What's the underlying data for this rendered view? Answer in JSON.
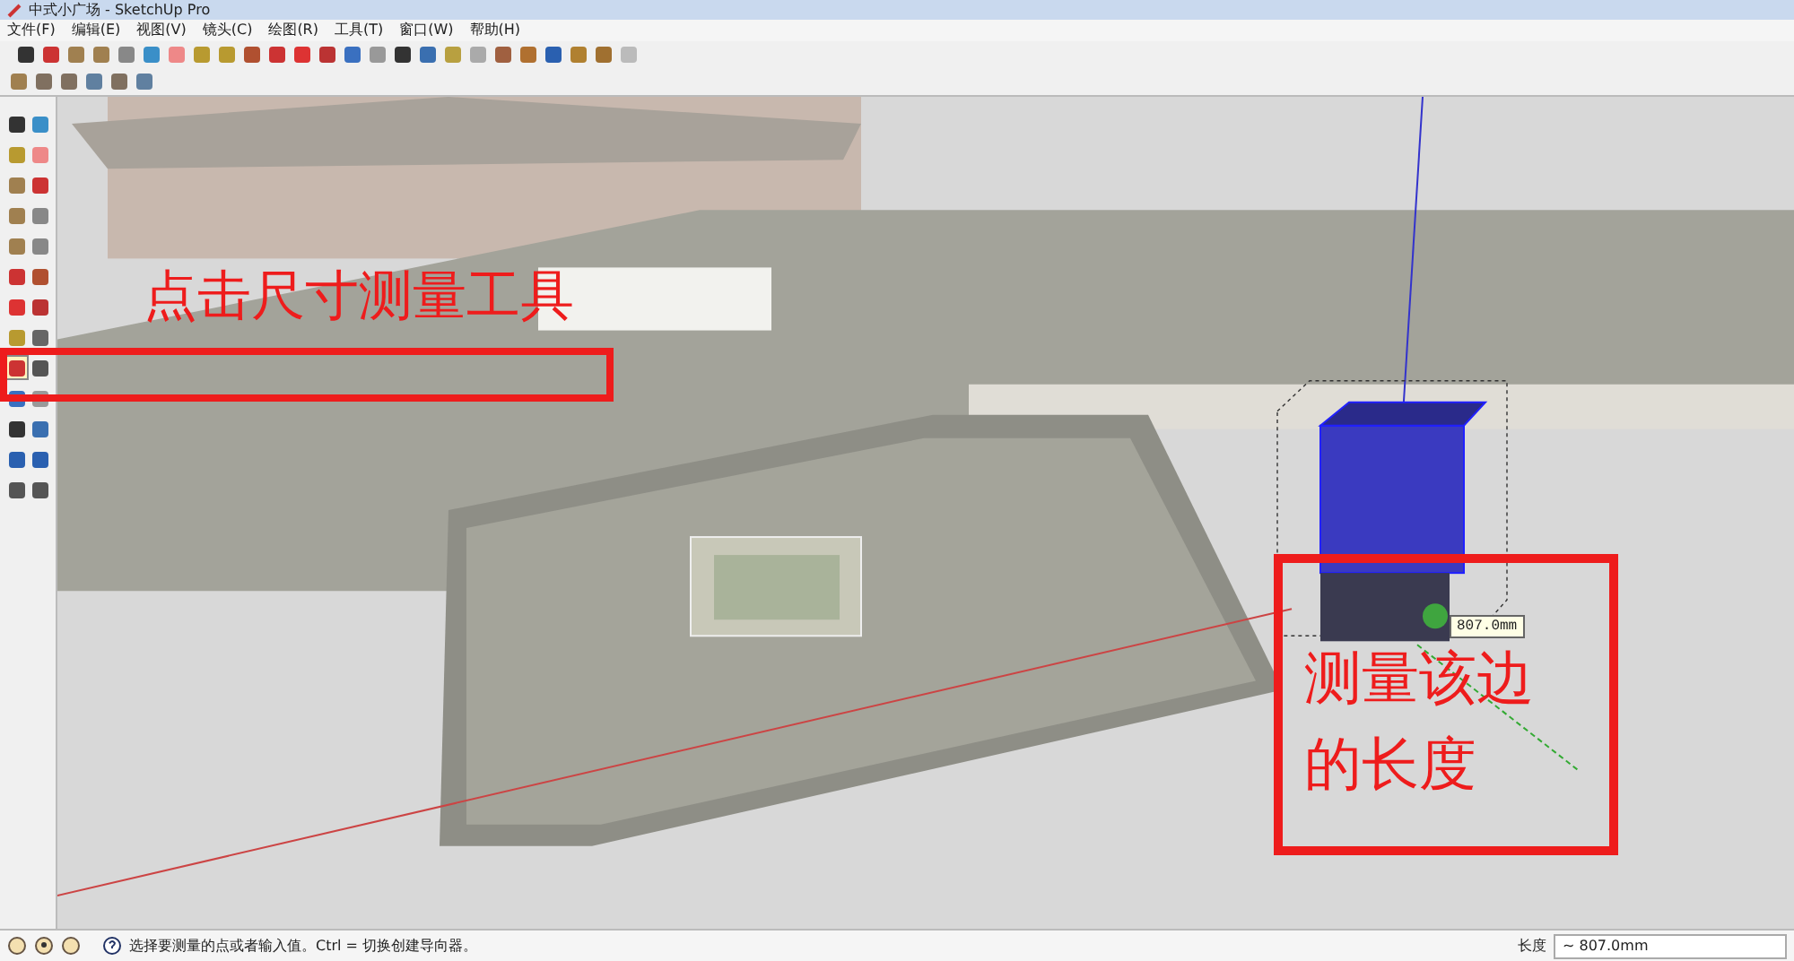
{
  "window": {
    "title": "中式小广场 - SketchUp Pro"
  },
  "menu": [
    "文件(F)",
    "编辑(E)",
    "视图(V)",
    "镜头(C)",
    "绘图(R)",
    "工具(T)",
    "窗口(W)",
    "帮助(H)"
  ],
  "tool_palette": [
    {
      "selected": false
    },
    {
      "selected": false
    },
    {
      "selected": false
    },
    {
      "selected": false
    },
    {
      "selected": false
    },
    {
      "selected": false
    },
    {
      "selected": false
    },
    {
      "selected": false
    },
    {
      "selected": false
    },
    {
      "selected": false
    },
    {
      "selected": false
    },
    {
      "selected": false
    },
    {
      "selected": false
    },
    {
      "selected": false
    },
    {
      "selected": false
    },
    {
      "selected": false
    },
    {
      "selected": true
    },
    {
      "selected": false
    },
    {
      "selected": false
    },
    {
      "selected": false
    },
    {
      "selected": false
    },
    {
      "selected": false
    },
    {
      "selected": false
    },
    {
      "selected": false
    },
    {
      "selected": false
    },
    {
      "selected": false
    }
  ],
  "annotations": [
    {
      "kind": "tool-callout",
      "text": "点击尺寸测量工具"
    },
    {
      "kind": "edge-callout",
      "text": "测量该边的长度"
    }
  ],
  "measure_tooltip": "807.0mm",
  "status_bar": {
    "hint": "选择要测量的点或者输入值。Ctrl = 切换创建导向器。",
    "measurement_label": "长度",
    "measurement_value": "~ 807.0mm"
  }
}
